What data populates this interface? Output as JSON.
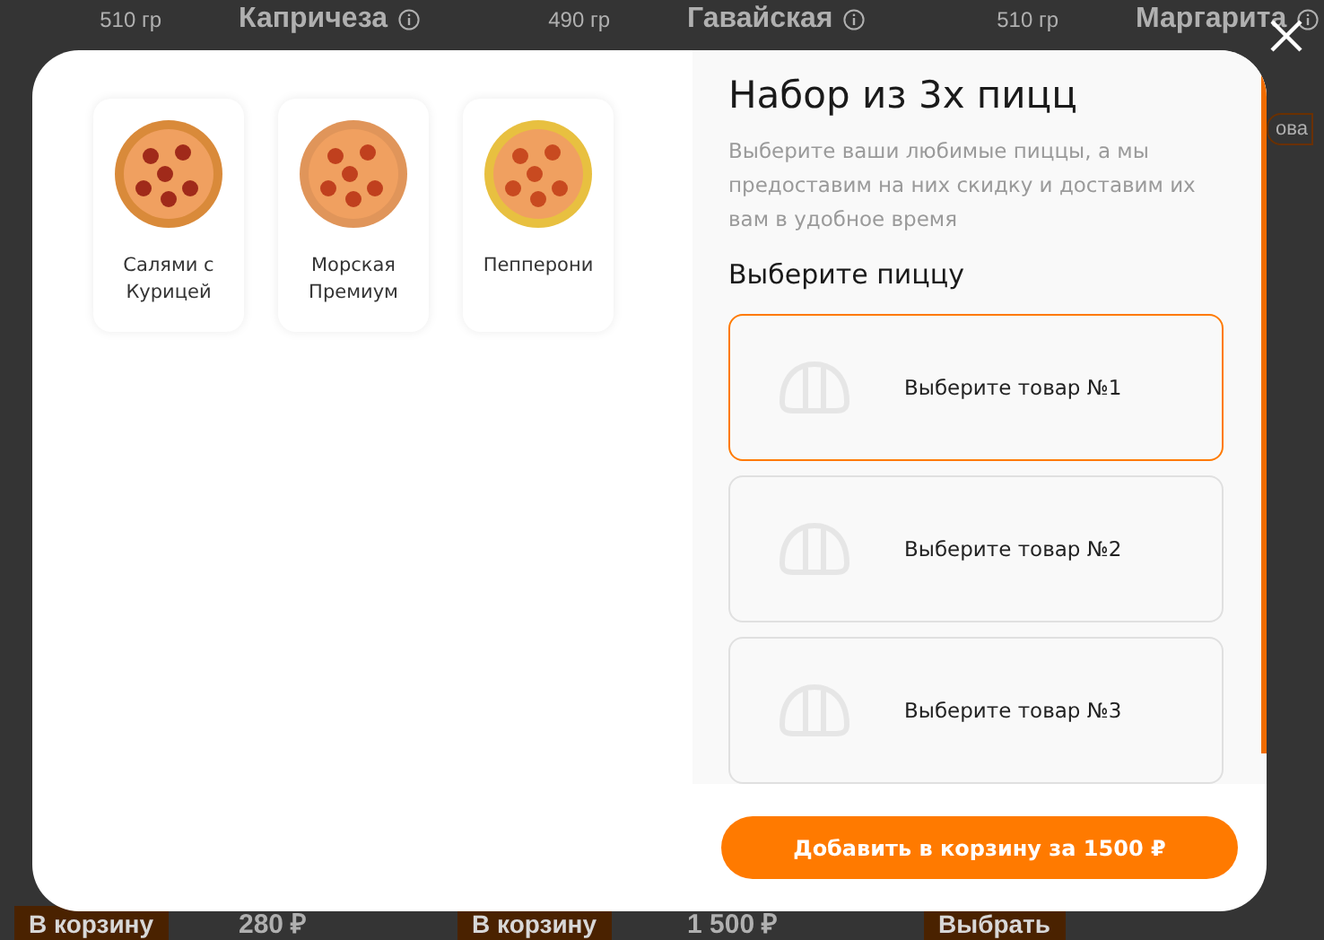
{
  "background_page": {
    "top_row": [
      {
        "weight": "510 гр"
      },
      {
        "name": "Капричеза",
        "weight": "490 гр"
      },
      {
        "name": "Гавайская",
        "weight": "510 гр"
      },
      {
        "name": "Маргарита"
      }
    ],
    "side_button": "ова",
    "bottom_row": [
      {
        "kind": "button",
        "text": "В корзину"
      },
      {
        "kind": "price",
        "text": "280 ₽"
      },
      {
        "kind": "button",
        "text": "В корзину"
      },
      {
        "kind": "price",
        "text": "1 500 ₽"
      },
      {
        "kind": "button",
        "text": "Выбрать"
      }
    ]
  },
  "modal": {
    "pizzas": [
      {
        "name": "Салями с Курицей"
      },
      {
        "name": "Морская Премиум"
      },
      {
        "name": "Пепперони"
      }
    ],
    "title": "Набор из 3х пицц",
    "description": "Выберите ваши любимые пиццы, а мы предоставим на них скидку и доставим их вам в удобное время",
    "subtitle": "Выберите пиццу",
    "slots": [
      {
        "label": "Выберите товар №1",
        "selected": true
      },
      {
        "label": "Выберите товар №2",
        "selected": false
      },
      {
        "label": "Выберите товар №3",
        "selected": false
      }
    ],
    "add_button": "Добавить в корзину за 1500 ₽"
  }
}
